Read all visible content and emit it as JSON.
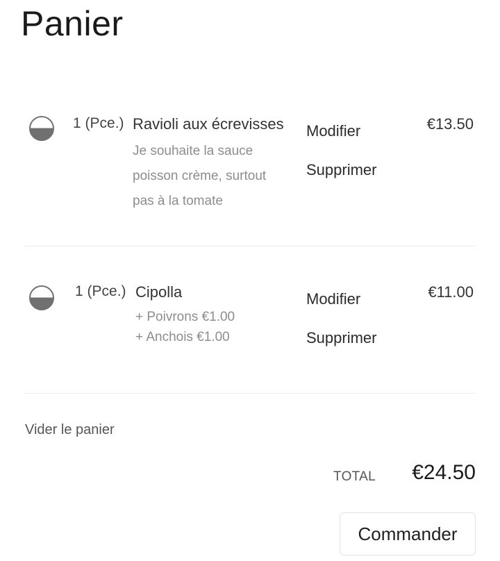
{
  "page": {
    "title": "Panier"
  },
  "cart": {
    "items": [
      {
        "quantity": "1 (Pce.)",
        "name": "Ravioli aux écrevisses",
        "note": "Je souhaite la sauce poisson crème, surtout pas à la tomate",
        "options": [],
        "modify_label": "Modifier",
        "delete_label": "Supprimer",
        "price": "€13.50",
        "icon": "half-circle-icon"
      },
      {
        "quantity": "1 (Pce.)",
        "name": "Cipolla",
        "note": "",
        "options": [
          "+ Poivrons €1.00",
          "+ Anchois €1.00"
        ],
        "modify_label": "Modifier",
        "delete_label": "Supprimer",
        "price": "€11.00",
        "icon": "half-circle-icon"
      }
    ],
    "empty_cart_label": "Vider le panier",
    "total_label": "TOTAL",
    "total_amount": "€24.50",
    "order_button_label": "Commander"
  },
  "colors": {
    "icon": "#707070",
    "muted_text": "#8d8d8d",
    "divider": "#ececec"
  }
}
